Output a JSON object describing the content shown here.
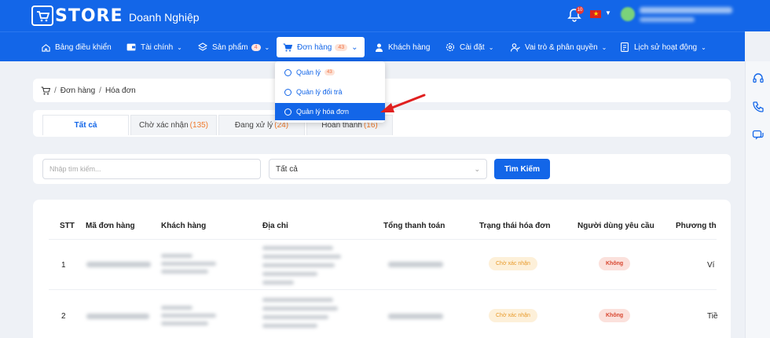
{
  "header": {
    "logo_text": "STORE",
    "brand_subtitle": "Doanh Nghiệp",
    "notification_count": "10"
  },
  "nav": {
    "items": [
      {
        "label": "Bảng điều khiển",
        "icon": "home-icon"
      },
      {
        "label": "Tài chính",
        "icon": "wallet-icon"
      },
      {
        "label": "Sản phẩm",
        "icon": "layers-icon",
        "badge": "4"
      },
      {
        "label": "Đơn hàng",
        "icon": "cart-icon",
        "badge": "43"
      },
      {
        "label": "Khách hàng",
        "icon": "user-icon"
      },
      {
        "label": "Cài đặt",
        "icon": "gear-icon"
      },
      {
        "label": "Vai trò & phân quyền",
        "icon": "users-icon"
      },
      {
        "label": "Lịch sử hoạt động",
        "icon": "history-icon"
      }
    ]
  },
  "dropdown": {
    "items": [
      {
        "label": "Quản lý",
        "badge": "43"
      },
      {
        "label": "Quản lý đổi trả"
      },
      {
        "label": "Quản lý hóa đơn"
      }
    ]
  },
  "breadcrumb": {
    "items": [
      "Đơn hàng",
      "Hóa đơn"
    ]
  },
  "tabs": [
    {
      "label": "Tất cả",
      "count": ""
    },
    {
      "label": "Chờ xác nhận ",
      "count": "(135)"
    },
    {
      "label": "Đang xử lý ",
      "count": "(24)"
    },
    {
      "label": "Hoàn thành ",
      "count": "(16)"
    }
  ],
  "search": {
    "placeholder": "Nhập tìm kiếm...",
    "select_value": "Tất cả",
    "button_label": "Tìm Kiếm"
  },
  "table": {
    "headers": [
      "STT",
      "Mã đơn hàng",
      "Khách hàng",
      "Địa chỉ",
      "Tổng thanh toán",
      "Trạng thái hóa đơn",
      "Người dùng yêu cầu",
      "Phương th"
    ],
    "rows": [
      {
        "stt": "1",
        "status": "Chờ xác nhận",
        "requester": "Không",
        "method": "Ví"
      },
      {
        "stt": "2",
        "status": "Chờ xác nhận",
        "requester": "Không",
        "method": "Tiề"
      }
    ]
  },
  "colors": {
    "primary": "#1366e8",
    "badge_orange": "#f07a2c",
    "danger": "#d8462f"
  }
}
